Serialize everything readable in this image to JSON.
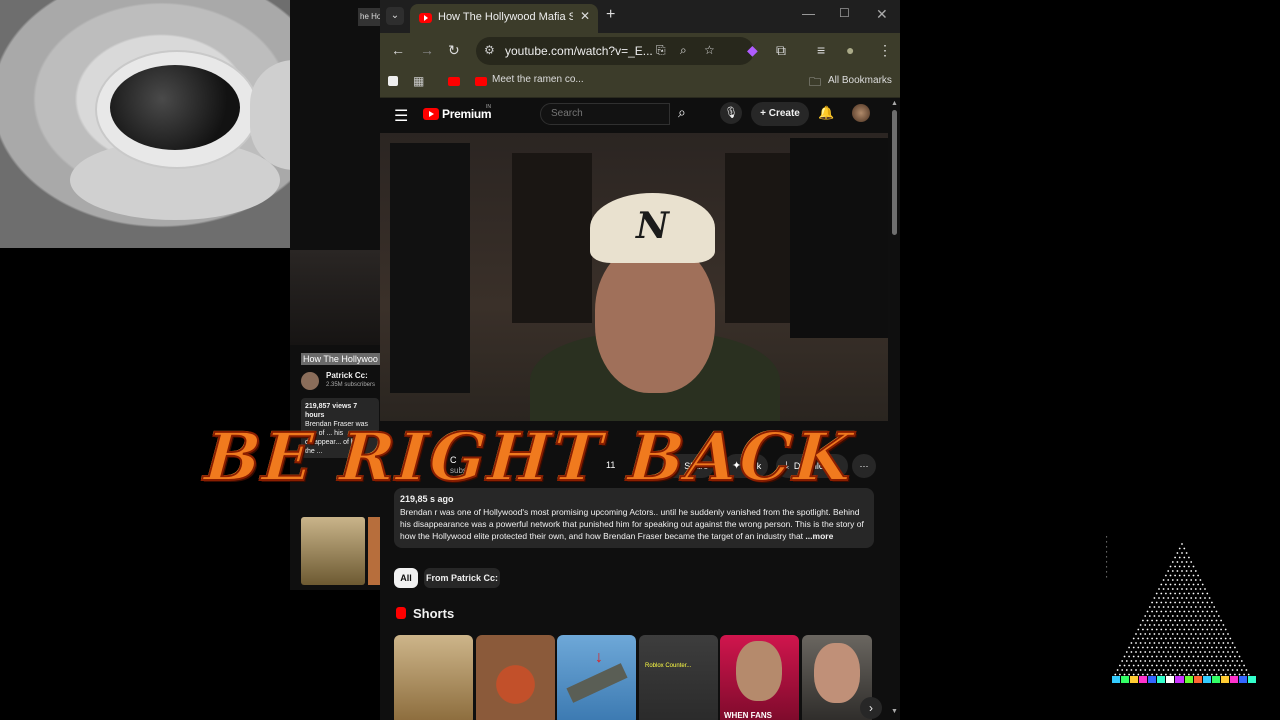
{
  "browser": {
    "active_tab_title": "How The Hollywood Mafia Silen",
    "url": "youtube.com/watch?v=_E...",
    "bookmarks": [
      "Meet the ramen co...",
      "All Bookmarks"
    ]
  },
  "youtube": {
    "logo_text": "Premium",
    "logo_badge": "IN",
    "search_placeholder": "Search",
    "create_label": "Create",
    "video": {
      "channel_fragment": "C",
      "subs_fragment": "subs",
      "likes_fragment": "11",
      "actions": [
        "Share",
        "Ask",
        "Download"
      ],
      "description_meta": "219,85    s           ago",
      "description": "Brendan    r was one of Hollywood's most promising upcoming Actors.. until he suddenly vanished from the spotlight. Behind his disappearance was a powerful network that punished him for speaking out against the wrong person. This is the story of how the Hollywood elite protected their own, and how Brendan Fraser became the target of an industry that",
      "more": "...more"
    },
    "chips": [
      "All",
      "From Patrick Cc:"
    ],
    "shorts_title": "Shorts",
    "shorts_captions": [
      "",
      "",
      "",
      "Roblox Counter...",
      "WHEN FANS",
      ""
    ]
  },
  "background_window": {
    "tab_fragment": "he Ho",
    "title_fragment": "How The Hollywoo",
    "channel": "Patrick Cc:",
    "subscribers": "2.35M subscribers",
    "meta": "219,857 views  7 hours",
    "desc_fragment": "Brendan Fraser was one of ... his disappear... of how the ..."
  },
  "overlay": {
    "text": "BE RIGHT BACK"
  },
  "icons": {
    "window": [
      "chevron-down-icon",
      "close-icon",
      "plus-icon",
      "minimize-icon",
      "maximize-icon"
    ],
    "toolbar": [
      "back-icon",
      "forward-icon",
      "reload-icon",
      "site-settings-icon",
      "cast-icon",
      "zoom-icon",
      "star-icon",
      "extension-icon",
      "puzzle-icon",
      "media-icon",
      "profile-icon",
      "kebab-icon"
    ]
  },
  "colors": {
    "brand_red": "#ff0000",
    "overlay_orange": "#f07a1e",
    "toolbar_olive": "#3c3c2a"
  }
}
